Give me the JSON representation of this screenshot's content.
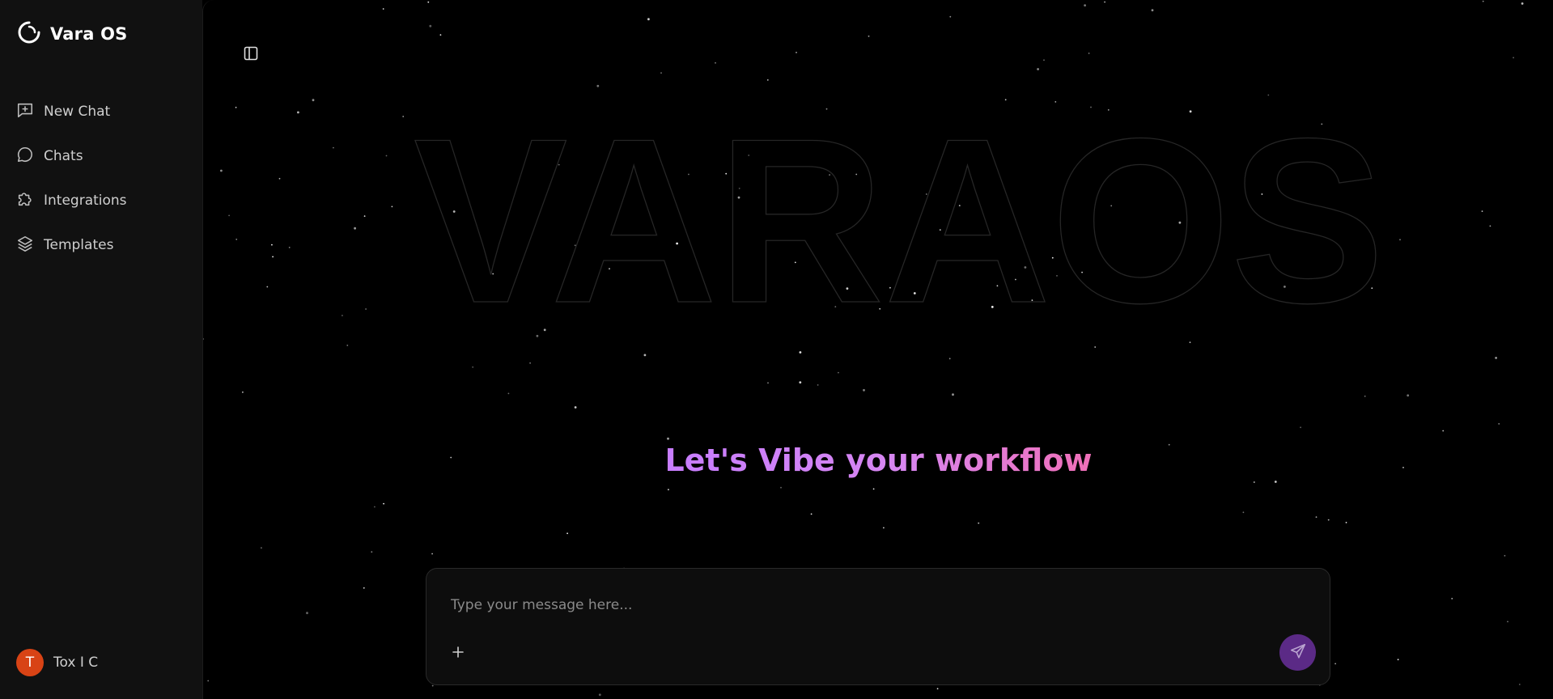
{
  "app": {
    "brand_name": "Vara OS"
  },
  "sidebar": {
    "items": [
      {
        "label": "New Chat",
        "icon": "new-chat-icon"
      },
      {
        "label": "Chats",
        "icon": "chat-bubble-icon"
      },
      {
        "label": "Integrations",
        "icon": "puzzle-icon"
      },
      {
        "label": "Templates",
        "icon": "layers-icon"
      }
    ],
    "user": {
      "initial": "T",
      "name": "Tox I C"
    }
  },
  "main": {
    "background_word": "VARAOS",
    "headline": "Let's Vibe your workflow",
    "composer": {
      "placeholder": "Type your message here...",
      "value": ""
    }
  },
  "colors": {
    "sidebar_bg": "#111111",
    "main_bg": "#000000",
    "accent_purple": "#5b2a86",
    "avatar": "#d84315",
    "headline_gradient": [
      "#c77dff",
      "#f06fb8"
    ]
  }
}
